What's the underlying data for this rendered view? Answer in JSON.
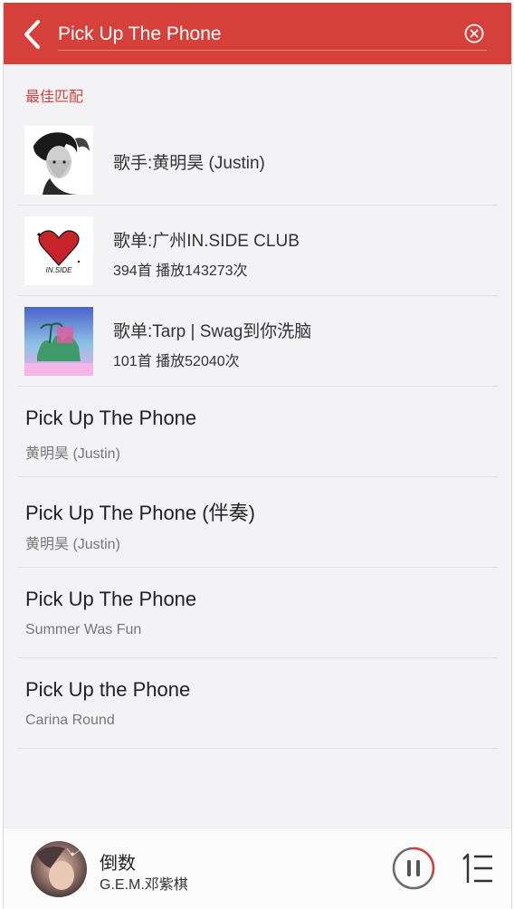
{
  "header": {
    "search_value": "Pick Up The Phone",
    "back_icon": "chevron-left-icon",
    "clear_icon": "close-circle-icon"
  },
  "section": {
    "title": "最佳匹配"
  },
  "best_matches": [
    {
      "title": "歌手:黄明昊 (Justin)",
      "subtitle": "",
      "thumb": "artist-photo"
    },
    {
      "title": "歌单:广州IN.SIDE CLUB",
      "subtitle": "394首 播放143273次",
      "thumb": "inside-club-cover",
      "thumb_text": "IN.SIDE"
    },
    {
      "title": "歌单:Tarp | Swag到你洗脑",
      "subtitle": "101首 播放52040次",
      "thumb": "tarp-swag-cover"
    }
  ],
  "songs": [
    {
      "title": "Pick Up The Phone",
      "artist": "黄明昊 (Justin)"
    },
    {
      "title": "Pick Up The Phone (伴奏)",
      "artist": "黄明昊 (Justin)"
    },
    {
      "title": "Pick Up The Phone",
      "artist": "Summer Was Fun"
    },
    {
      "title": "Pick Up the Phone",
      "artist": "Carina Round"
    }
  ],
  "player": {
    "title": "倒数",
    "artist": "G.E.M.邓紫棋",
    "progress": 0.3,
    "pause_icon": "pause-icon",
    "playlist_icon": "playlist-icon"
  },
  "colors": {
    "accent": "#d6403b",
    "background": "#f3f3f5"
  }
}
